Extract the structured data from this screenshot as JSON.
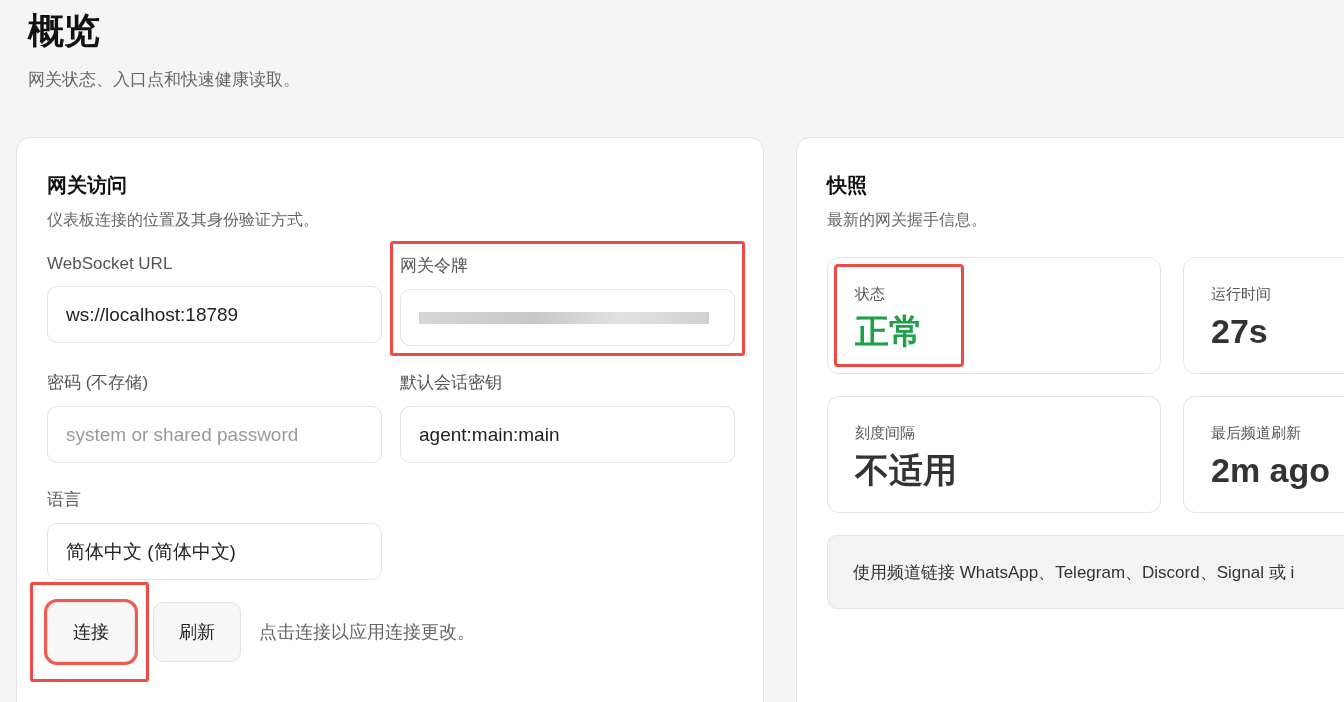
{
  "page": {
    "title": "概览",
    "subtitle": "网关状态、入口点和快速健康读取。"
  },
  "access": {
    "title": "网关访问",
    "description": "仪表板连接的位置及其身份验证方式。",
    "fields": [
      {
        "label": "WebSocket URL",
        "value": "ws://localhost:18789"
      },
      {
        "label": "网关令牌",
        "redacted": true,
        "highlighted": true
      },
      {
        "label": "密码 (不存储)",
        "placeholder": "system or shared password"
      },
      {
        "label": "默认会话密钥",
        "value": "agent:main:main"
      },
      {
        "label": "语言",
        "value": "简体中文 (简体中文)"
      }
    ],
    "buttons": [
      {
        "label": "连接",
        "focused": true,
        "highlighted": true
      },
      {
        "label": "刷新",
        "focused": false
      }
    ],
    "hint": "点击连接以应用连接更改。"
  },
  "snapshot": {
    "title": "快照",
    "description": "最新的网关握手信息。",
    "tiles": [
      {
        "label": "状态",
        "value": "正常",
        "kind": "status",
        "highlighted": true
      },
      {
        "label": "运行时间",
        "value": "27s",
        "kind": "plain"
      },
      {
        "label": "刻度间隔",
        "value": "不适用",
        "kind": "plain"
      },
      {
        "label": "最后频道刷新",
        "value": "2m ago",
        "kind": "plain"
      }
    ],
    "note": "使用频道链接 WhatsApp、Telegram、Discord、Signal 或 i"
  }
}
